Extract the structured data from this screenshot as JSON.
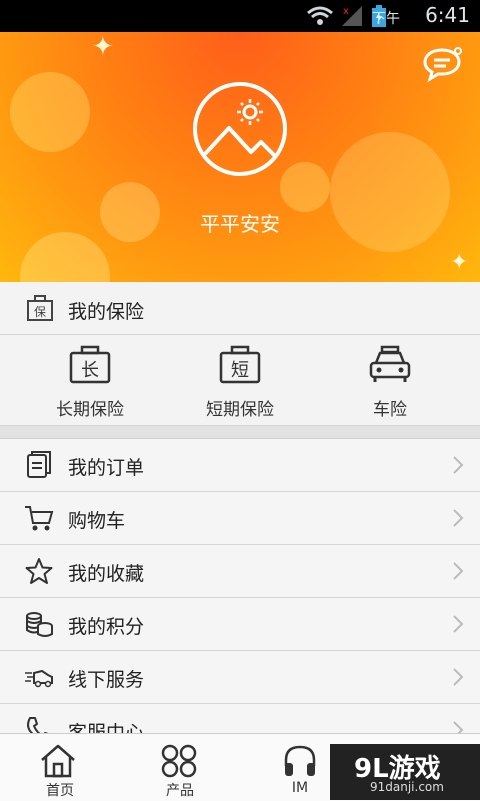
{
  "status_bar": {
    "period": "下午",
    "time": "6:41"
  },
  "header": {
    "username": "平平安安"
  },
  "insurance": {
    "title": "我的保险",
    "title_icon_char": "保",
    "items": [
      {
        "label": "长期保险",
        "icon_char": "长"
      },
      {
        "label": "短期保险",
        "icon_char": "短"
      },
      {
        "label": "车险",
        "icon": "car-icon"
      }
    ]
  },
  "menu": {
    "items": [
      {
        "label": "我的订单",
        "icon": "order-icon"
      },
      {
        "label": "购物车",
        "icon": "cart-icon"
      },
      {
        "label": "我的收藏",
        "icon": "star-icon"
      },
      {
        "label": "我的积分",
        "icon": "coins-icon"
      },
      {
        "label": "线下服务",
        "icon": "delivery-icon"
      },
      {
        "label": "客服中心",
        "icon": "phone-icon"
      }
    ]
  },
  "tabbar": {
    "tabs": [
      {
        "label": "首页",
        "icon": "home-icon"
      },
      {
        "label": "产品",
        "icon": "grid-icon"
      },
      {
        "label": "IM",
        "icon": "headphones-icon"
      }
    ]
  },
  "watermark": {
    "brand": "9L游戏",
    "site": "91danji.com"
  }
}
